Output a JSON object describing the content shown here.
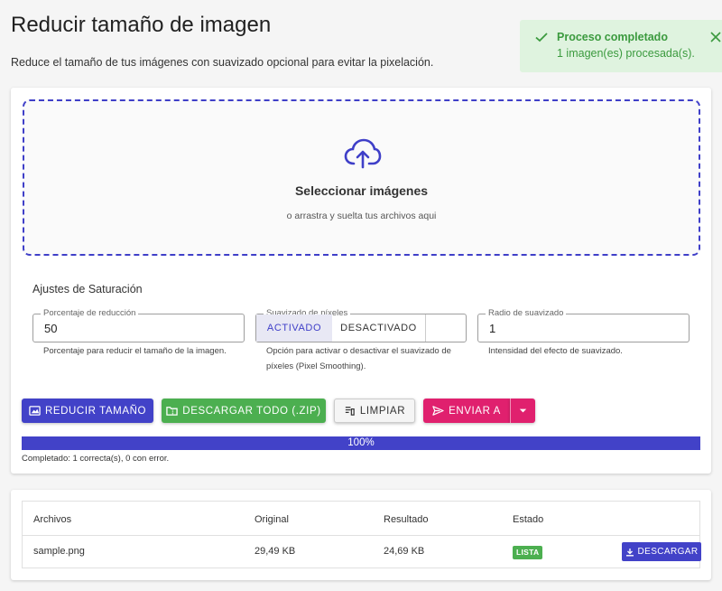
{
  "header": {
    "title": "Reducir tamaño de imagen",
    "subtitle": "Reduce el tamaño de tus imágenes con suavizado opcional para evitar la pixelación."
  },
  "toast": {
    "title": "Proceso completado",
    "message": "1 imagen(es) procesada(s)."
  },
  "dropzone": {
    "title": "Seleccionar imágenes",
    "subtitle": "o arrastra y suelta tus archivos aqui"
  },
  "settings": {
    "title": "Ajustes de Saturación",
    "reduction": {
      "label": "Porcentaje de reducción",
      "value": "50",
      "helper": "Porcentaje para reducir el tamaño de la imagen."
    },
    "smoothing": {
      "label": "Suavizado de píxeles",
      "option_on": "ACTIVADO",
      "option_off": "DESACTIVADO",
      "selected": "ACTIVADO",
      "helper": "Opción para activar o desactivar el suavizado de píxeles (Pixel Smoothing)."
    },
    "radius": {
      "label": "Radio de suavizado",
      "value": "1",
      "helper": "Intensidad del efecto de suavizado."
    }
  },
  "actions": {
    "reduce": "REDUCIR TAMAÑO",
    "download_zip": "DESCARGAR TODO (.ZIP)",
    "clear": "LIMPIAR",
    "send_to": "ENVIAR A"
  },
  "progress": {
    "value": 100,
    "label": "100%",
    "status": "Completado: 1 correcta(s), 0 con error."
  },
  "table": {
    "headers": [
      "Archivos",
      "Original",
      "Resultado",
      "Estado"
    ],
    "rows": [
      {
        "file": "sample.png",
        "original": "29,49 KB",
        "result": "24,69 KB",
        "status": "LISTA",
        "action": "DESCARGAR"
      }
    ]
  },
  "colors": {
    "primary": "#4242c8",
    "success": "#4caf50",
    "accent": "#e0206e",
    "toast_bg": "#dff3df"
  }
}
